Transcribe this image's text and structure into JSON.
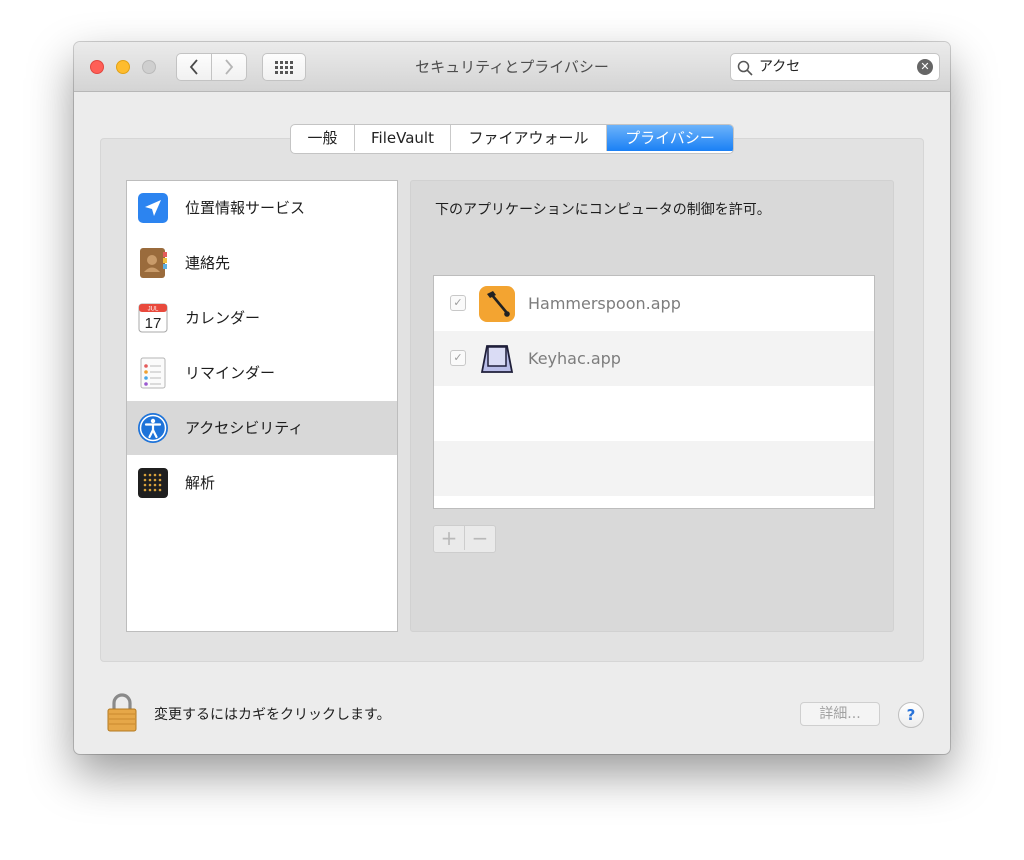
{
  "window": {
    "title": "セキュリティとプライバシー"
  },
  "search": {
    "value": "アクセ",
    "clear_symbol": "✕"
  },
  "tabs": [
    {
      "label": "一般",
      "selected": false
    },
    {
      "label": "FileVault",
      "selected": false
    },
    {
      "label": "ファイアウォール",
      "selected": false
    },
    {
      "label": "プライバシー",
      "selected": true
    }
  ],
  "privacy_list": [
    {
      "label": "位置情報サービス",
      "icon": "location-arrow-icon",
      "selected": false
    },
    {
      "label": "連絡先",
      "icon": "contacts-book-icon",
      "selected": false
    },
    {
      "label": "カレンダー",
      "icon": "calendar-icon",
      "selected": false
    },
    {
      "label": "リマインダー",
      "icon": "reminders-icon",
      "selected": false
    },
    {
      "label": "アクセシビリティ",
      "icon": "accessibility-icon",
      "selected": true
    },
    {
      "label": "解析",
      "icon": "analytics-icon",
      "selected": false
    }
  ],
  "calendar_icon": {
    "month": "JUL",
    "day": "17"
  },
  "right_pane": {
    "description": "下のアプリケーションにコンピュータの制御を許可。",
    "apps": [
      {
        "name": "Hammerspoon.app",
        "checked": true,
        "check_symbol": "✓",
        "icon": "hammer-icon"
      },
      {
        "name": "Keyhac.app",
        "checked": true,
        "check_symbol": "✓",
        "icon": "keycap-icon"
      }
    ],
    "add_symbol": "+",
    "remove_symbol": "−"
  },
  "footer": {
    "lock_text": "変更するにはカギをクリックします。",
    "advanced_label": "詳細...",
    "help_label": "?"
  },
  "colors": {
    "tab_selected": "#1a80f5",
    "list_selected": "#d8d8d8",
    "close": "#ff5f57",
    "minimize": "#febc2e"
  }
}
